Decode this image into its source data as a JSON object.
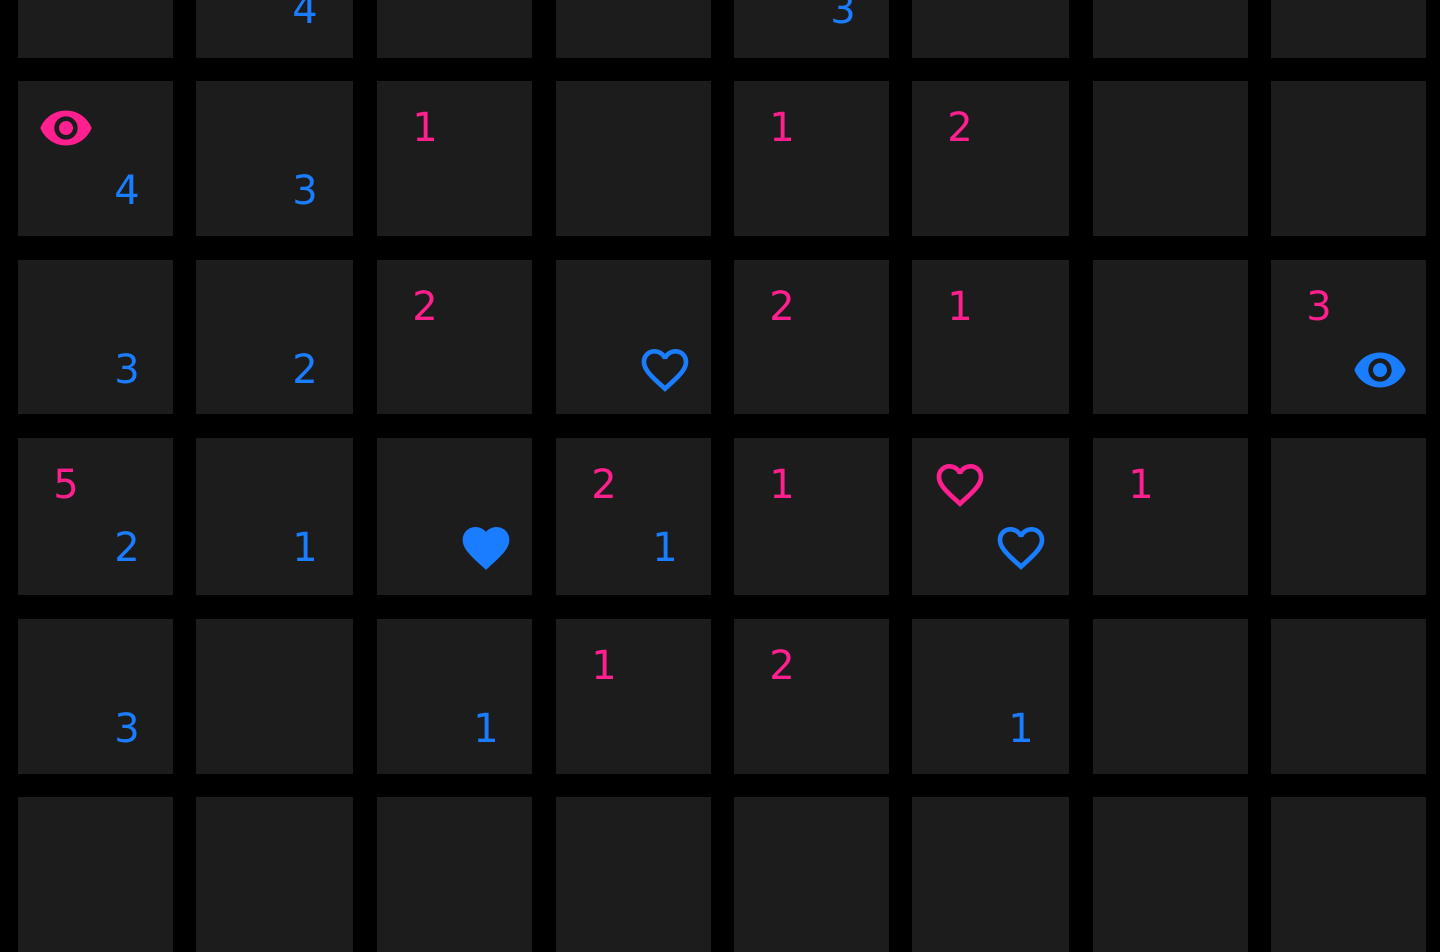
{
  "colors": {
    "pink": "#ff1f8e",
    "blue": "#1a7dff",
    "cell": "#1c1c1c",
    "background": "#000000"
  },
  "board": {
    "rows": [
      [
        {},
        {
          "bottom": {
            "type": "number",
            "value": "4",
            "color": "blue"
          }
        },
        {},
        {},
        {
          "bottom": {
            "type": "number",
            "value": "3",
            "color": "blue"
          }
        },
        {},
        {},
        {}
      ],
      [
        {
          "top": {
            "type": "icon",
            "icon": "eye-icon",
            "color": "pink"
          },
          "bottom": {
            "type": "number",
            "value": "4",
            "color": "blue"
          }
        },
        {
          "bottom": {
            "type": "number",
            "value": "3",
            "color": "blue"
          }
        },
        {
          "top": {
            "type": "number",
            "value": "1",
            "color": "pink"
          }
        },
        {},
        {
          "top": {
            "type": "number",
            "value": "1",
            "color": "pink"
          }
        },
        {
          "top": {
            "type": "number",
            "value": "2",
            "color": "pink"
          }
        },
        {},
        {}
      ],
      [
        {
          "bottom": {
            "type": "number",
            "value": "3",
            "color": "blue"
          }
        },
        {
          "bottom": {
            "type": "number",
            "value": "2",
            "color": "blue"
          }
        },
        {
          "top": {
            "type": "number",
            "value": "2",
            "color": "pink"
          }
        },
        {
          "bottom": {
            "type": "icon",
            "icon": "heart-outline-icon",
            "color": "blue"
          }
        },
        {
          "top": {
            "type": "number",
            "value": "2",
            "color": "pink"
          }
        },
        {
          "top": {
            "type": "number",
            "value": "1",
            "color": "pink"
          }
        },
        {},
        {
          "top": {
            "type": "number",
            "value": "3",
            "color": "pink"
          },
          "bottom": {
            "type": "icon",
            "icon": "eye-icon",
            "color": "blue"
          }
        }
      ],
      [
        {
          "top": {
            "type": "number",
            "value": "5",
            "color": "pink"
          },
          "bottom": {
            "type": "number",
            "value": "2",
            "color": "blue"
          }
        },
        {
          "bottom": {
            "type": "number",
            "value": "1",
            "color": "blue"
          }
        },
        {
          "bottom": {
            "type": "icon",
            "icon": "heart-filled-icon",
            "color": "blue"
          }
        },
        {
          "top": {
            "type": "number",
            "value": "2",
            "color": "pink"
          },
          "bottom": {
            "type": "number",
            "value": "1",
            "color": "blue"
          }
        },
        {
          "top": {
            "type": "number",
            "value": "1",
            "color": "pink"
          }
        },
        {
          "top": {
            "type": "icon",
            "icon": "heart-outline-icon",
            "color": "pink"
          },
          "bottom": {
            "type": "icon",
            "icon": "heart-outline-icon",
            "color": "blue"
          }
        },
        {
          "top": {
            "type": "number",
            "value": "1",
            "color": "pink"
          }
        },
        {}
      ],
      [
        {
          "bottom": {
            "type": "number",
            "value": "3",
            "color": "blue"
          }
        },
        {},
        {
          "bottom": {
            "type": "number",
            "value": "1",
            "color": "blue"
          }
        },
        {
          "top": {
            "type": "number",
            "value": "1",
            "color": "pink"
          }
        },
        {
          "top": {
            "type": "number",
            "value": "2",
            "color": "pink"
          }
        },
        {
          "bottom": {
            "type": "number",
            "value": "1",
            "color": "blue"
          }
        },
        {},
        {}
      ],
      [
        {},
        {},
        {},
        {},
        {},
        {},
        {},
        {}
      ]
    ]
  }
}
